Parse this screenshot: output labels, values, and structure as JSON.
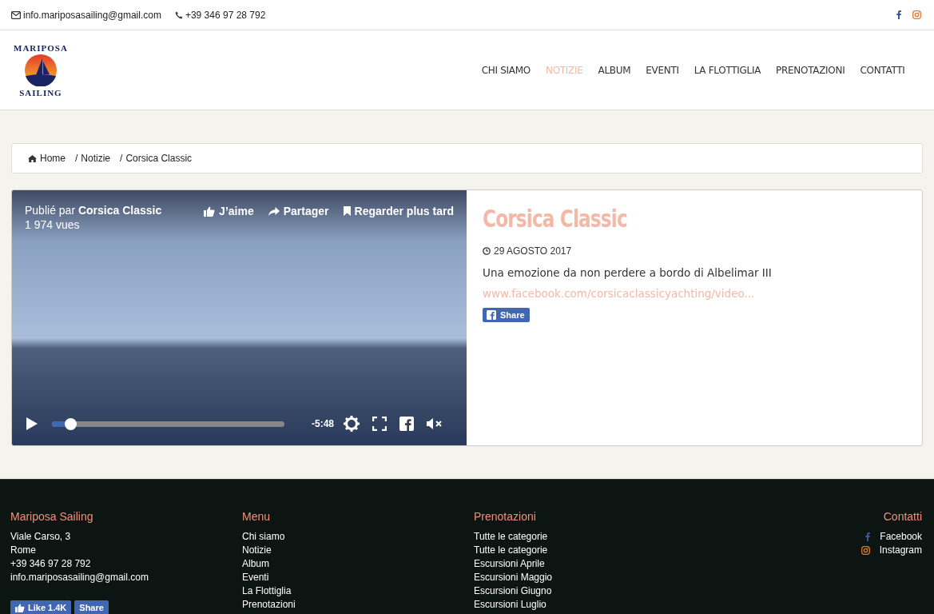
{
  "top_bar": {
    "email": "info.mariposasailing@gmail.com",
    "phone": "+39 346 97 28 792"
  },
  "logo": {
    "top": "MARIPOSA",
    "bottom": "SAILING"
  },
  "nav": [
    {
      "label": "CHI SIAMO",
      "selected": false
    },
    {
      "label": "NOTIZIE",
      "selected": true
    },
    {
      "label": "ALBUM",
      "selected": false
    },
    {
      "label": "EVENTI",
      "selected": false
    },
    {
      "label": "LA FLOTTIGLIA",
      "selected": false
    },
    {
      "label": "PRENOTAZIONI",
      "selected": false
    },
    {
      "label": "CONTATTI",
      "selected": false
    }
  ],
  "breadcrumb": [
    "Home",
    "Notizie",
    "Corsica Classic"
  ],
  "breadcrumb_separators": [
    "/",
    "/"
  ],
  "video": {
    "published_by_prefix": "Publié par",
    "publisher": "Corsica Classic",
    "views": "1 974 vues",
    "actions": [
      "J’aime",
      "Partager",
      "Regarder plus tard"
    ],
    "level": 0.08,
    "time": "-5:48"
  },
  "article": {
    "title": "Corsica Classic",
    "date": "29 AGOSTO 2017",
    "text": "Una emozione da non perdere a bordo di Albelimar III",
    "link": "www.facebook.com/corsicaclassicyachting/video...",
    "share": "Share"
  },
  "footer": {
    "about": {
      "title": "Mariposa Sailing",
      "lines": [
        "Viale Carso, 3",
        "Rome",
        "+39 346 97 28 792",
        "info.mariposasailing@gmail.com"
      ],
      "like": "Like 1.4K",
      "share": "Share"
    },
    "menu": {
      "title": "Menu",
      "items": [
        "Chi siamo",
        "Notizie",
        "Album",
        "Eventi",
        "La Flottiglia",
        "Prenotazioni"
      ]
    },
    "bookings": {
      "title": "Prenotazioni",
      "items": [
        "Tutte le categorie",
        "Tutte le categorie",
        "Escursioni Aprile",
        "Escursioni Maggio",
        "Escursioni Giugno",
        "Escursioni Luglio"
      ]
    },
    "contacts": {
      "title": "Contatti",
      "items": [
        "Facebook",
        "Instagram"
      ]
    }
  }
}
